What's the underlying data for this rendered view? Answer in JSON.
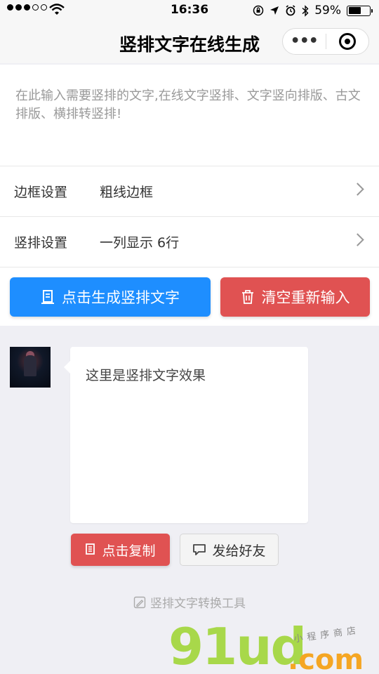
{
  "status_bar": {
    "time": "16:36",
    "battery_text": "59%",
    "battery_level": 0.59
  },
  "nav": {
    "title": "竖排文字在线生成"
  },
  "input": {
    "placeholder": "在此输入需要竖排的文字,在线文字竖排、文字竖向排版、古文排版、横排转竖排!"
  },
  "settings": [
    {
      "label": "边框设置",
      "value": "粗线边框"
    },
    {
      "label": "竖排设置",
      "value": "一列显示 6行"
    }
  ],
  "actions": {
    "generate": "点击生成竖排文字",
    "clear": "清空重新输入"
  },
  "preview": {
    "text": "这里是竖排文字效果"
  },
  "result_actions": {
    "copy": "点击复制",
    "share": "发给好友"
  },
  "footer": {
    "text": "竖排文字转换工具"
  },
  "watermark": {
    "logo": "91ud",
    "domain": ".com",
    "tagline": "小程序商店"
  },
  "colors": {
    "primary": "#1e8eff",
    "danger": "#e05252",
    "watermark_green": "#a8d84a",
    "watermark_orange": "#f5a623"
  }
}
